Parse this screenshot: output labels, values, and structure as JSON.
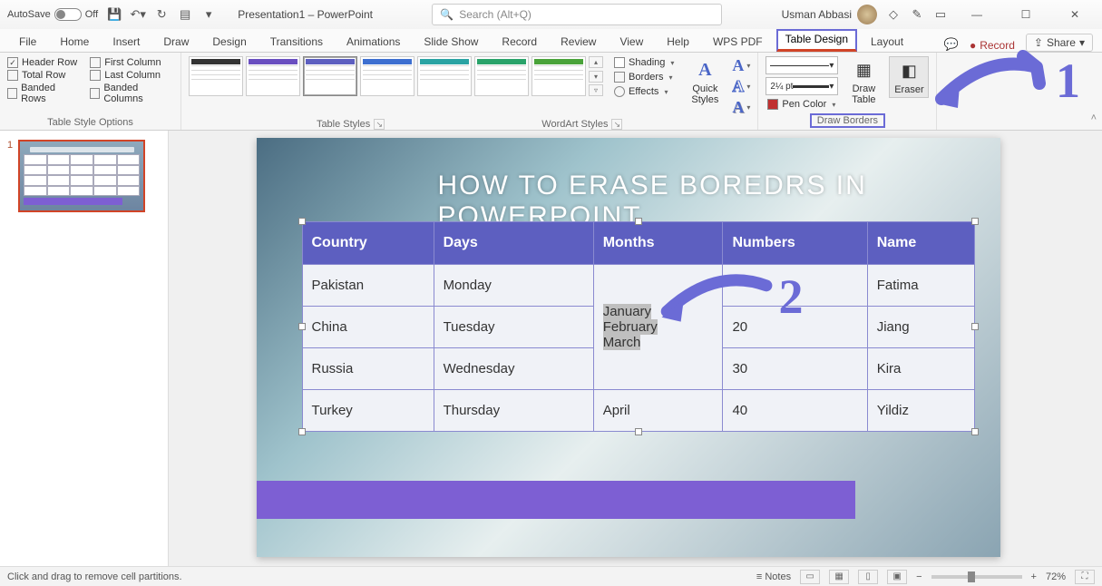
{
  "titlebar": {
    "autosave_label": "AutoSave",
    "autosave_state": "Off",
    "doc_title": "Presentation1 – PowerPoint",
    "search_placeholder": "Search (Alt+Q)",
    "user_name": "Usman Abbasi"
  },
  "tabs": {
    "items": [
      "File",
      "Home",
      "Insert",
      "Draw",
      "Design",
      "Transitions",
      "Animations",
      "Slide Show",
      "Record",
      "Review",
      "View",
      "Help",
      "WPS PDF",
      "Table Design",
      "Layout"
    ],
    "active": "Table Design",
    "record_btn": "Record",
    "share_btn": "Share"
  },
  "ribbon": {
    "style_options": {
      "label": "Table Style Options",
      "header_row": "Header Row",
      "total_row": "Total Row",
      "banded_rows": "Banded Rows",
      "first_column": "First Column",
      "last_column": "Last Column",
      "banded_columns": "Banded Columns"
    },
    "table_styles_label": "Table Styles",
    "shading": "Shading",
    "borders": "Borders",
    "effects": "Effects",
    "quick_styles": "Quick Styles",
    "wordart_label": "WordArt Styles",
    "pen_weight": "2¼ pt",
    "pen_color": "Pen Color",
    "draw_table": "Draw Table",
    "eraser": "Eraser",
    "draw_borders_label": "Draw Borders"
  },
  "slidepanel": {
    "slide_number": "1"
  },
  "slide": {
    "title": "HOW TO ERASE BOREDRS IN POWERPOINT",
    "headers": [
      "Country",
      "Days",
      "Months",
      "Numbers",
      "Name"
    ],
    "rows": [
      {
        "country": "Pakistan",
        "days": "Monday",
        "months": "",
        "numbers": "",
        "name": "Fatima"
      },
      {
        "country": "China",
        "days": "Tuesday",
        "months": "January February March",
        "numbers": "20",
        "name": "Jiang"
      },
      {
        "country": "Russia",
        "days": "Wednesday",
        "months": "",
        "numbers": "30",
        "name": "Kira"
      },
      {
        "country": "Turkey",
        "days": "Thursday",
        "months": "April",
        "numbers": "40",
        "name": "Yildiz"
      }
    ]
  },
  "overlay": {
    "num1": "1",
    "num2": "2"
  },
  "status": {
    "hint": "Click and drag to remove cell partitions.",
    "notes": "Notes",
    "zoom": "72%"
  }
}
